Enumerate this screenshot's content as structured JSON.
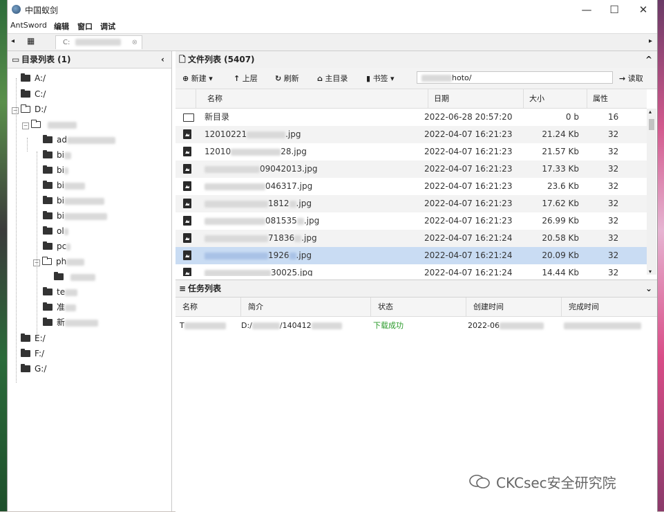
{
  "window": {
    "title": "中国蚁剑",
    "minimize_icon": "—",
    "maximize_icon": "☐",
    "close_icon": "✕"
  },
  "menu": [
    "AntSword",
    "编辑",
    "窗口",
    "调试"
  ],
  "tab": {
    "label": "C:"
  },
  "dir_panel": {
    "title": "目录列表 (1)",
    "collapse_icon": "‹",
    "items": [
      {
        "label": "A:/"
      },
      {
        "label": "C:/"
      },
      {
        "label": "D:/"
      },
      {
        "label": " "
      },
      {
        "label": "ad"
      },
      {
        "label": "bi"
      },
      {
        "label": "bi"
      },
      {
        "label": "bi"
      },
      {
        "label": "bi"
      },
      {
        "label": "bi"
      },
      {
        "label": "ol"
      },
      {
        "label": "pc"
      },
      {
        "label": "ph"
      },
      {
        "label": " "
      },
      {
        "label": "te"
      },
      {
        "label": "准"
      },
      {
        "label": "新"
      },
      {
        "label": "E:/"
      },
      {
        "label": "F:/"
      },
      {
        "label": "G:/"
      }
    ]
  },
  "file_panel": {
    "title": "文件列表 (5407)",
    "collapse_icon": "^",
    "toolbar": {
      "new": "新建",
      "up": "上层",
      "refresh": "刷新",
      "home": "主目录",
      "bookmark": "书签",
      "path": "hoto/",
      "read": "读取"
    },
    "columns": [
      "名称",
      "日期",
      "大小",
      "属性"
    ],
    "rows": [
      {
        "type": "dir",
        "name": "新目录",
        "date": "2022-06-28 20:57:20",
        "size": "0 b",
        "attr": "16"
      },
      {
        "type": "file",
        "name": "12010221",
        "name_tail": ".jpg",
        "date": "2022-04-07 16:21:23",
        "size": "21.24 Kb",
        "attr": "32"
      },
      {
        "type": "file",
        "name": "12010",
        "name_tail": "28.jpg",
        "date": "2022-04-07 16:21:23",
        "size": "21.57 Kb",
        "attr": "32"
      },
      {
        "type": "file",
        "name": "",
        "name_tail": "09042013.jpg",
        "date": "2022-04-07 16:21:23",
        "size": "17.33 Kb",
        "attr": "32"
      },
      {
        "type": "file",
        "name": "",
        "name_tail": "046317.jpg",
        "date": "2022-04-07 16:21:23",
        "size": "23.6 Kb",
        "attr": "32"
      },
      {
        "type": "file",
        "name": "",
        "name_tail": "1812",
        "name_tail2": ".jpg",
        "date": "2022-04-07 16:21:23",
        "size": "17.62 Kb",
        "attr": "32"
      },
      {
        "type": "file",
        "name": "",
        "name_tail": "081535",
        "name_tail2": ".jpg",
        "date": "2022-04-07 16:21:23",
        "size": "26.99 Kb",
        "attr": "32"
      },
      {
        "type": "file",
        "name": "",
        "name_tail": "71836",
        "name_tail2": ".jpg",
        "date": "2022-04-07 16:21:24",
        "size": "20.58 Kb",
        "attr": "32"
      },
      {
        "type": "file",
        "name": "",
        "name_tail": "1926",
        "name_tail2": ".jpg",
        "date": "2022-04-07 16:21:24",
        "size": "20.09 Kb",
        "attr": "32"
      },
      {
        "type": "file",
        "name": "",
        "name_tail": "30025.jpg",
        "date": "2022-04-07 16:21:24",
        "size": "14.44 Kb",
        "attr": "32"
      }
    ]
  },
  "task_panel": {
    "title": "任务列表",
    "collapse_icon": "⌄",
    "columns": [
      "名称",
      "简介",
      "状态",
      "创建时间",
      "完成时间"
    ],
    "row": {
      "name": "T",
      "desc": "D:/",
      "desc_tail": "/140412",
      "status": "下载成功",
      "created": "2022-06"
    },
    "status_color": "#2a9a2a"
  },
  "watermark": "CKCsec安全研究院"
}
